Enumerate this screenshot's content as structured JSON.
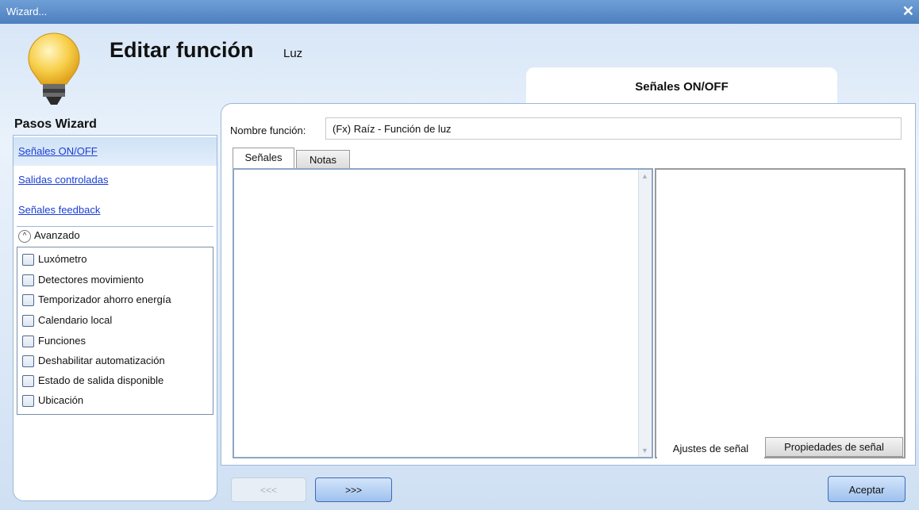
{
  "window": {
    "title": "Wizard..."
  },
  "header": {
    "title": "Editar función",
    "subtitle": "Luz",
    "current_step": "Señales ON/OFF"
  },
  "sidebar": {
    "heading": "Pasos Wizard",
    "steps": [
      {
        "label": "Señales ON/OFF",
        "active": true
      },
      {
        "label": "Salidas controladas",
        "active": false
      },
      {
        "label": "Señales feedback",
        "active": false
      }
    ],
    "advanced_label": "Avanzado",
    "options": [
      "Luxómetro",
      "Detectores movimiento",
      "Temporizador ahorro energía",
      "Calendario local",
      "Funciones",
      "Deshabilitar automatización",
      "Estado de salida disponible",
      "Ubicación"
    ]
  },
  "main": {
    "name_label": "Nombre función:",
    "name_value": "(Fx) Raíz - Función de luz",
    "tabs": [
      "Señales",
      "Notas"
    ],
    "bottom_tabs": [
      "Ajustes de señal",
      "Propiedades de señal"
    ]
  },
  "footer": {
    "prev_label": "<<<",
    "next_label": ">>>",
    "ok_label": "Aceptar"
  },
  "colors": {
    "accent": "#4d7fbf",
    "link": "#1a3ed6",
    "bulb": "#f5c842"
  }
}
